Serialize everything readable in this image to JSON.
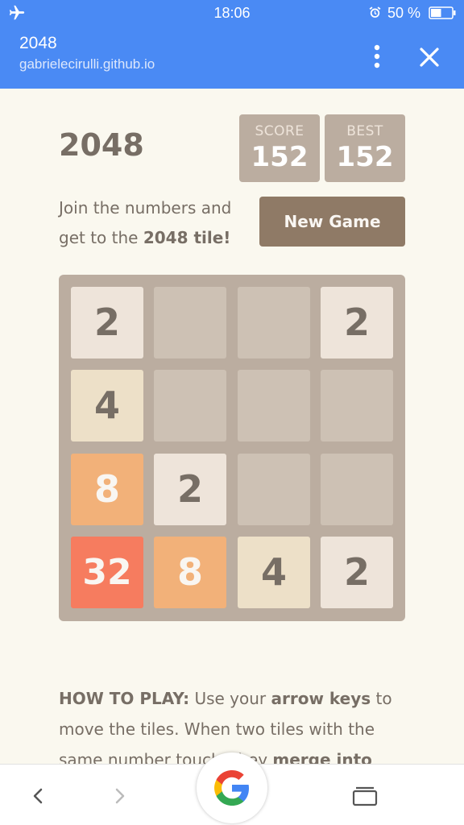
{
  "status_bar": {
    "time": "18:06",
    "battery_percent": "50 %",
    "battery_level": 0.5,
    "icons": [
      "airplane-mode-icon",
      "alarm-icon",
      "battery-icon"
    ]
  },
  "browser": {
    "title": "2048",
    "url": "gabrielecirulli.github.io",
    "icons": [
      "more-vert-icon",
      "close-icon"
    ]
  },
  "game": {
    "heading": "2048",
    "score_label": "SCORE",
    "score_value": "152",
    "best_label": "BEST",
    "best_value": "152",
    "intro_part1": "Join the numbers and get to the ",
    "intro_bold": "2048 tile!",
    "new_game_label": "New Game",
    "grid": [
      [
        2,
        null,
        null,
        2
      ],
      [
        4,
        null,
        null,
        null
      ],
      [
        8,
        2,
        null,
        null
      ],
      [
        32,
        8,
        4,
        2
      ]
    ],
    "tile_colors": {
      "2": {
        "bg": "#eee4da",
        "fg": "#776e65"
      },
      "4": {
        "bg": "#ede0c8",
        "fg": "#776e65"
      },
      "8": {
        "bg": "#f2b179",
        "fg": "#f9f6f2"
      },
      "32": {
        "bg": "#f67c5f",
        "fg": "#f9f6f2"
      }
    }
  },
  "how_to_play": {
    "label": "HOW TO PLAY:",
    "text1": " Use your ",
    "bold1": "arrow keys",
    "text2": " to move the tiles. When two tiles with the same number touch, they ",
    "bold2": "merge into"
  },
  "colors": {
    "accent": "#4a8af4",
    "page_bg": "#faf8ef",
    "board_bg": "#bbada0",
    "empty_cell": "#cdc1b4",
    "button_bg": "#8f7a66"
  },
  "bottom_nav": {
    "icons": [
      "back-icon",
      "forward-icon",
      "google-icon",
      "tabs-icon"
    ]
  }
}
